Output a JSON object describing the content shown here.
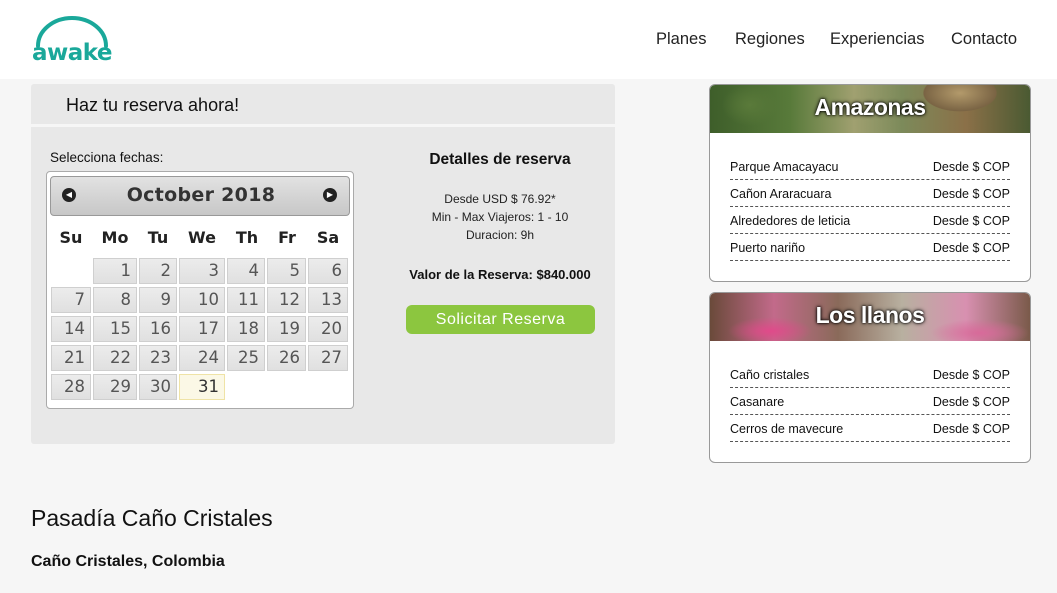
{
  "brand": {
    "logo_text": "awake",
    "color": "#1aa89a"
  },
  "nav": [
    "Planes",
    "Regiones",
    "Experiencias",
    "Contacto"
  ],
  "booking": {
    "title": "Haz tu reserva ahora!",
    "select_label": "Selecciona fechas:",
    "calendar": {
      "month_label": "October 2018",
      "prev_icon": "chevron-left-icon",
      "next_icon": "chevron-right-icon",
      "weekdays": [
        "Su",
        "Mo",
        "Tu",
        "We",
        "Th",
        "Fr",
        "Sa"
      ],
      "days": [
        "1",
        "2",
        "3",
        "4",
        "5",
        "6",
        "7",
        "8",
        "9",
        "10",
        "11",
        "12",
        "13",
        "14",
        "15",
        "16",
        "17",
        "18",
        "19",
        "20",
        "21",
        "22",
        "23",
        "24",
        "25",
        "26",
        "27",
        "28",
        "29",
        "30",
        "31"
      ],
      "highlighted_day": "31"
    },
    "details": {
      "title": "Detalles de reserva",
      "price_from": "Desde USD $ 76.92*",
      "travelers": "Min - Max Viajeros: 1 - 10",
      "duration": "Duracion: 9h",
      "total": "Valor de la Reserva: $840.000",
      "button": "Solicitar Reserva",
      "button_color": "#8cc63f"
    }
  },
  "regions": [
    {
      "title": "Amazonas",
      "places": [
        {
          "name": "Parque Amacayacu",
          "price": "Desde $ COP"
        },
        {
          "name": "Cañon Araracuara",
          "price": "Desde $ COP"
        },
        {
          "name": "Alrededores de leticia",
          "price": "Desde $ COP"
        },
        {
          "name": "Puerto nariño",
          "price": "Desde $ COP"
        }
      ]
    },
    {
      "title": "Los llanos",
      "places": [
        {
          "name": "Caño cristales",
          "price": "Desde $ COP"
        },
        {
          "name": "Casanare",
          "price": "Desde $ COP"
        },
        {
          "name": "Cerros de mavecure",
          "price": "Desde $ COP"
        }
      ]
    }
  ],
  "page": {
    "title": "Pasadía Caño Cristales",
    "subtitle": "Caño Cristales, Colombia"
  }
}
